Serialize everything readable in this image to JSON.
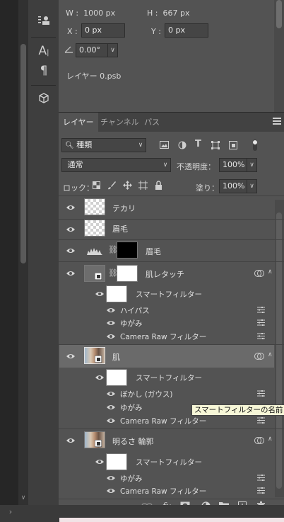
{
  "properties": {
    "w_label": "W :",
    "w_value": "1000 px",
    "h_label": "H :",
    "h_value": "667 px",
    "x_label": "X :",
    "x_value": "0 px",
    "y_label": "Y :",
    "y_value": "0 px",
    "angle_value": "0.00°",
    "filename": "レイヤー 0.psb"
  },
  "layers_panel": {
    "tabs": [
      "レイヤー",
      "チャンネル",
      "パス"
    ],
    "filter_kind": "種類",
    "blend_mode": "通常",
    "opacity_label": "不透明度：",
    "opacity_value": "100%",
    "lock_label": "ロック：",
    "fill_label": "塗り：",
    "fill_value": "100%"
  },
  "layers": [
    {
      "name": "テカリ",
      "thumb": "transparent"
    },
    {
      "name": "眉毛",
      "thumb": "transparent"
    },
    {
      "name": "眉毛",
      "thumb": "levels-mask"
    },
    {
      "name": "肌レタッチ",
      "thumb": "smart-mask",
      "smart_filter": "スマートフィルター",
      "filters": [
        "ハイパス",
        "ゆがみ",
        "Camera Raw フィルター"
      ]
    },
    {
      "name": "肌",
      "thumb": "photo",
      "smart_filter": "スマートフィルター",
      "filters": [
        "ぼかし (ガウス)",
        "ゆがみ",
        "Camera Raw フィルター"
      ]
    },
    {
      "name": "明るさ 輪郭",
      "thumb": "photo",
      "smart_filter": "スマートフィルター",
      "filters": [
        "ゆがみ",
        "Camera Raw フィルター"
      ]
    }
  ],
  "tooltip": "スマートフィルターの名前",
  "footer_icons": [
    "link-icon",
    "fx-icon",
    "mask-icon",
    "adjustment-icon",
    "folder-icon",
    "new-layer-icon",
    "trash-icon"
  ],
  "colors": {
    "panel_bg": "#535353",
    "selected_row": "#6a6a6a",
    "tooltip_bg": "#f7f7d7"
  }
}
